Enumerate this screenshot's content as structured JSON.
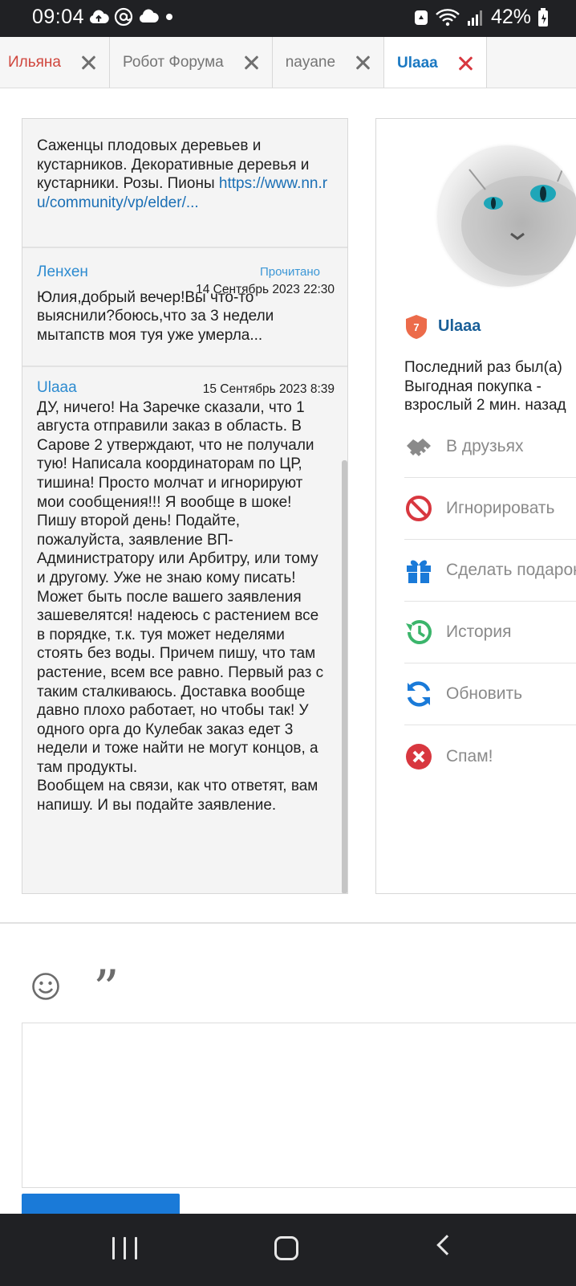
{
  "status_bar": {
    "time": "09:04",
    "battery": "42%",
    "icons": [
      "cloud-upload-icon",
      "at-icon",
      "cloud-icon",
      "dot-icon",
      "recycle-icon",
      "wifi-icon",
      "signal-icon",
      "battery-icon"
    ]
  },
  "tabs": [
    {
      "label": "Ильяна",
      "active": false
    },
    {
      "label": "Робот Форума",
      "active": false
    },
    {
      "label": "nayane",
      "active": false
    },
    {
      "label": "Ulaaa",
      "active": true
    }
  ],
  "messages": [
    {
      "text": "Саженцы плодовых деревьев и кустарников. Декоративные деревья и кустарники. Розы. Пионы",
      "link": "https://www.nn.ru/community/vp/elder/..."
    },
    {
      "author": "Ленхен",
      "status": "Прочитано",
      "date": "14 Сентябрь 2023 22:30",
      "text": "Юлия,добрый вечер!Вы что-то выяснили?боюсь,что за 3 недели мытапств моя туя уже умерла..."
    },
    {
      "author": "Ulaaa",
      "date": "15 Сентябрь 2023 8:39",
      "text": "ДУ, ничего! На Заречке сказали, что 1 августа отправили заказ в область. В Сарове 2 утверждают, что не получали тую! Написала координаторам по ЦР, тишина! Просто молчат и игнорируют мои сообщения!!! Я вообще в шоке! Пишу второй день! Подайте, пожалуйста, заявление ВП-Администратору или Арбитру, или тому и другому. Уже не знаю кому писать! Может быть после вашего заявления зашевелятся! надеюсь с растением все в порядке, т.к. туя может неделями стоять без воды. Причем пишу, что там растение, всем все равно. Первый раз с таким сталкиваюсь. Доставка вообще давно плохо работает, но чтобы так! У одного орга до Кулебак заказ едет 3 недели и тоже найти не могут концов, а там продукты.\nВообщем на связи, как что ответят, вам напишу. И вы подайте заявление."
    }
  ],
  "profile": {
    "badge": "7",
    "username": "Ulaaa",
    "last_seen_line1": "Последний раз был(а)",
    "last_seen_line2": "Выгодная покупка -",
    "last_seen_line3": "взрослый 2 мин. назад",
    "actions": [
      {
        "label": "В друзьях",
        "icon": "handshake-icon",
        "color": "#8a8a8a"
      },
      {
        "label": "Игнорировать",
        "icon": "ban-icon",
        "color": "#d8373f"
      },
      {
        "label": "Сделать подарок",
        "icon": "gift-icon",
        "color": "#1a7ad8"
      },
      {
        "label": "История",
        "icon": "history-icon",
        "color": "#3bb56b"
      },
      {
        "label": "Обновить",
        "icon": "refresh-icon",
        "color": "#1a7ad8"
      },
      {
        "label": "Спам!",
        "icon": "close-circle-icon",
        "color": "#d8373f"
      }
    ]
  },
  "composer": {
    "emoji_icon": "smile-icon",
    "quote_icon": "quote-icon",
    "quote_glyph": "”"
  }
}
